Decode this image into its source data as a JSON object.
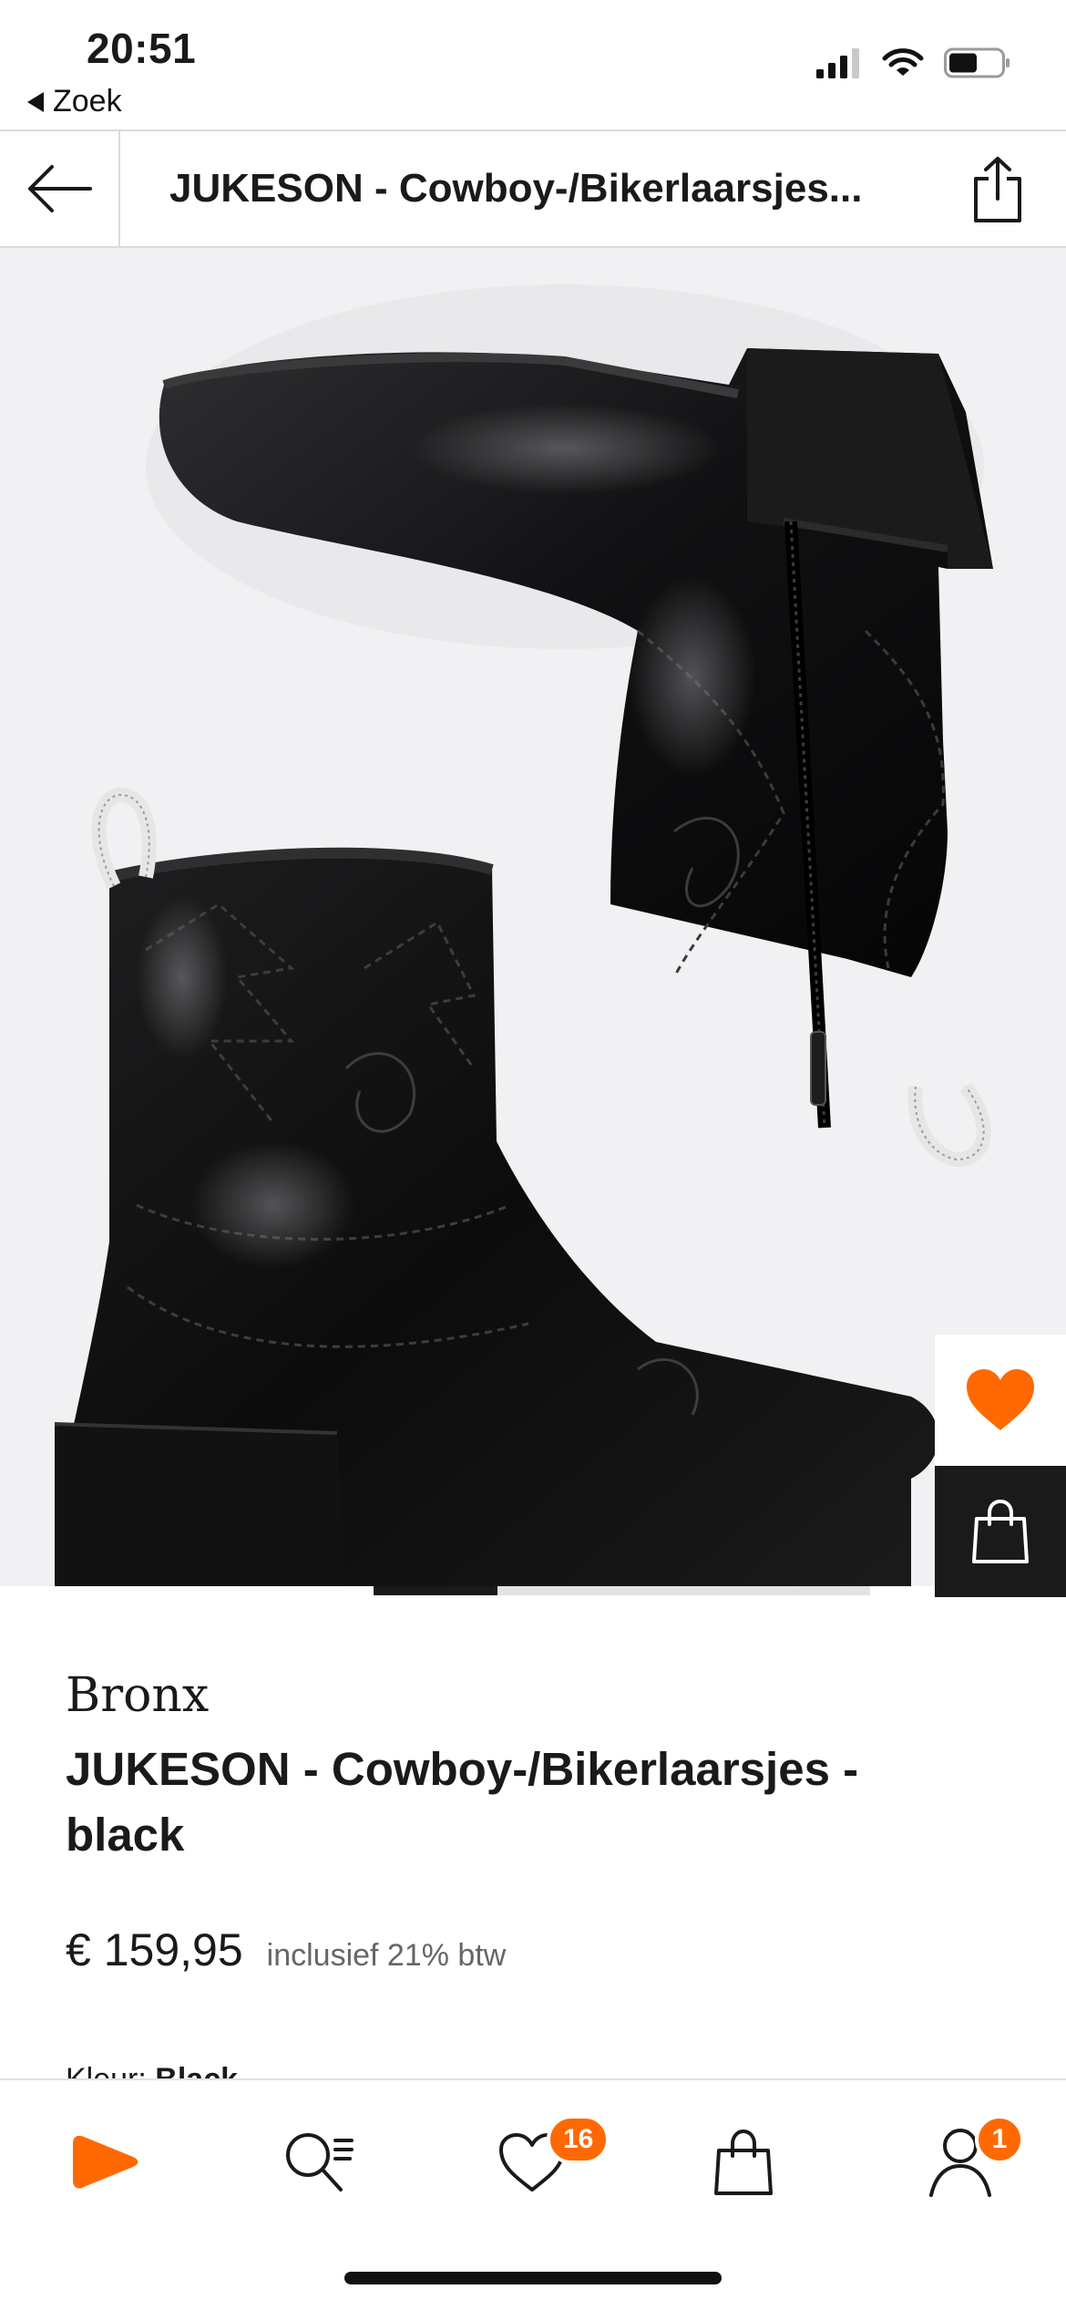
{
  "status_bar": {
    "time": "20:51",
    "back_app": "Zoek"
  },
  "nav": {
    "title": "JUKESON - Cowboy-/Bikerlaarsjes..."
  },
  "product": {
    "brand": "Bronx",
    "name": "JUKESON - Cowboy-/Bikerlaarsjes - black",
    "price": "€ 159,95",
    "vat_note": "inclusief 21% btw",
    "colour_label": "Kleur:",
    "colour_value": "Black",
    "image_slide": 1,
    "image_count": 4
  },
  "tab_bar": {
    "wishlist_count": "16",
    "account_count": "1"
  },
  "icons": {
    "back": "arrow-left-icon",
    "share": "share-icon",
    "favorite": "heart-icon",
    "add_to_bag": "bag-icon",
    "home": "play-icon",
    "search": "search-icon",
    "wishlist": "heart-icon",
    "cart": "bag-icon",
    "account": "person-icon"
  },
  "colors": {
    "accent": "#ff6900",
    "dark": "#1a1a1a",
    "hero_bg": "#f1f1f3"
  }
}
